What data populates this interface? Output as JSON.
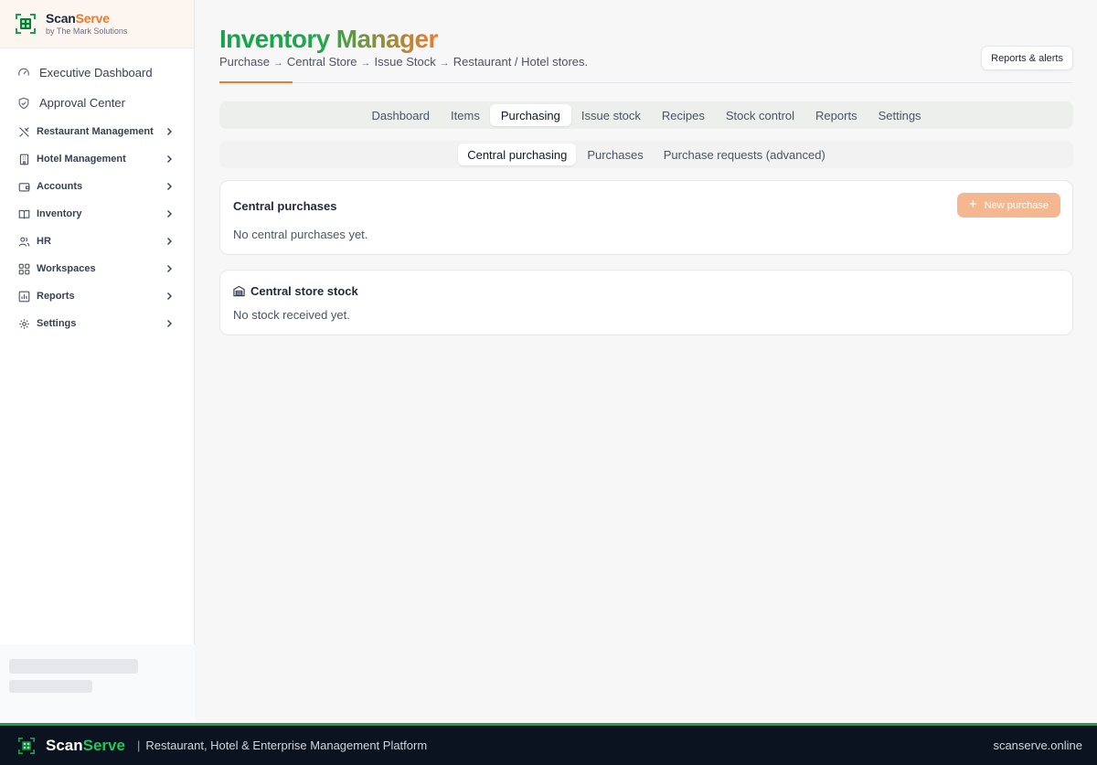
{
  "brand": {
    "name_part1": "Scan",
    "name_part2": "Serve",
    "subtitle": "by The Mark Solutions",
    "accent": "#f07a2c",
    "green": "#16a34a"
  },
  "sidebar": {
    "top_items": [
      {
        "label": "Executive Dashboard",
        "icon": "activity-icon"
      },
      {
        "label": "Approval Center",
        "icon": "shield-check-icon"
      }
    ],
    "groups": [
      {
        "label": "Restaurant Management",
        "icon": "utensils-icon"
      },
      {
        "label": "Hotel Management",
        "icon": "building-icon"
      },
      {
        "label": "Accounts",
        "icon": "wallet-icon"
      },
      {
        "label": "Inventory",
        "icon": "book-icon"
      },
      {
        "label": "HR",
        "icon": "users-icon"
      },
      {
        "label": "Workspaces",
        "icon": "grid-icon"
      },
      {
        "label": "Reports",
        "icon": "chart-icon"
      },
      {
        "label": "Settings",
        "icon": "gear-icon"
      }
    ]
  },
  "header": {
    "title": "Inventory Manager",
    "flow": [
      "Purchase",
      "Central Store",
      "Issue Stock",
      "Restaurant / Hotel stores."
    ],
    "flow_arrow": "→",
    "reports_button": "Reports & alerts"
  },
  "tabs": [
    "Dashboard",
    "Items",
    "Purchasing",
    "Issue stock",
    "Recipes",
    "Stock control",
    "Reports",
    "Settings"
  ],
  "active_tab": "Purchasing",
  "subtabs": [
    "Central purchasing",
    "Purchases",
    "Purchase requests (advanced)"
  ],
  "active_subtab": "Central purchasing",
  "central_purchases": {
    "title": "Central purchases",
    "empty_text": "No central purchases yet.",
    "new_button": "New purchase"
  },
  "central_store": {
    "title": "Central store stock",
    "empty_text": "No stock received yet."
  },
  "footer": {
    "name_part1": "Scan",
    "name_part2": "Serve",
    "separator": "|",
    "tagline": "Restaurant, Hotel & Enterprise Management Platform",
    "site": "scanserve.online"
  }
}
